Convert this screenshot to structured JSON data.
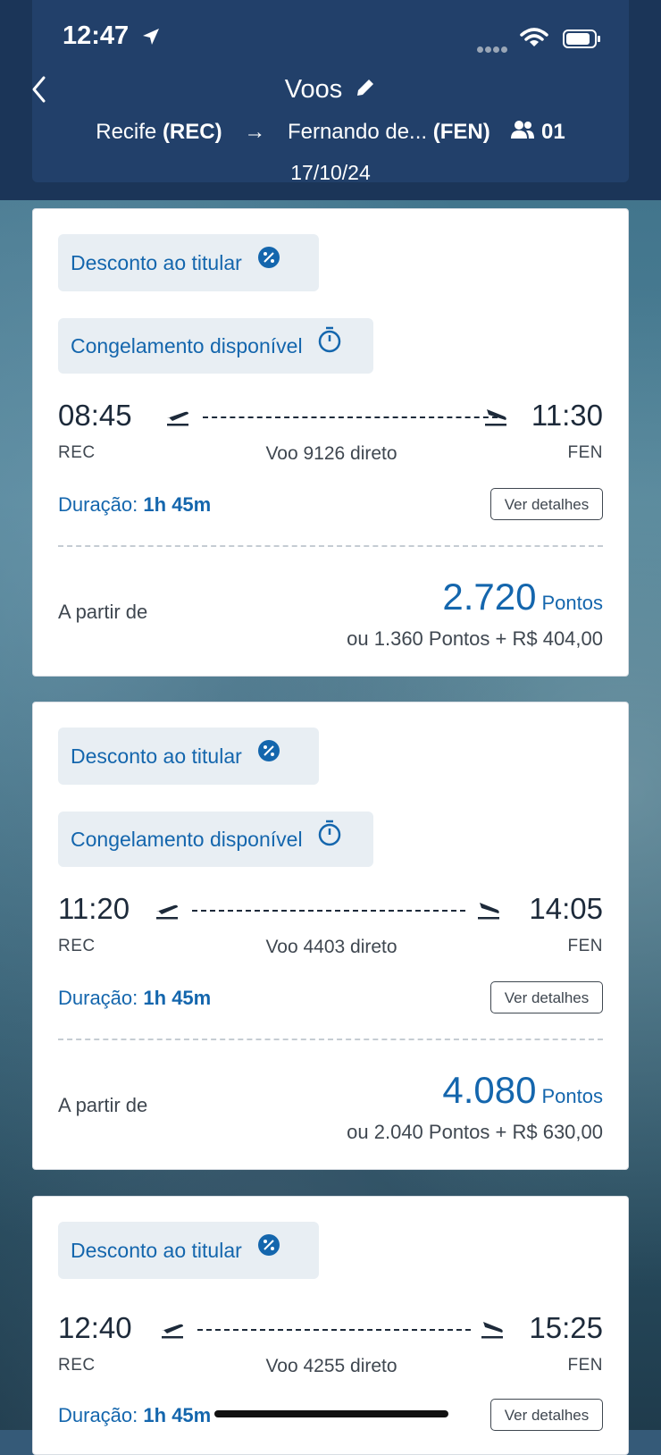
{
  "status_bar": {
    "time": "12:47"
  },
  "header": {
    "title": "Voos",
    "origin_city": "Recife",
    "origin_code": "(REC)",
    "destination_city": "Fernando de...",
    "destination_code": "(FEN)",
    "passengers": "01",
    "date": "17/10/24"
  },
  "flights": [
    {
      "badges": [
        "Desconto ao titular",
        "Congelamento disponível"
      ],
      "departure_time": "08:45",
      "arrival_time": "11:30",
      "origin": "REC",
      "destination": "FEN",
      "flight_label": "Voo 9126 direto",
      "duration_label": "Duração:",
      "duration": "1h 45m",
      "details_label": "Ver detalhes",
      "from_label": "A partir de",
      "points": "2.720",
      "points_unit": "Pontos",
      "alternative": "ou 1.360 Pontos + R$ 404,00"
    },
    {
      "badges": [
        "Desconto ao titular",
        "Congelamento disponível"
      ],
      "departure_time": "11:20",
      "arrival_time": "14:05",
      "origin": "REC",
      "destination": "FEN",
      "flight_label": "Voo 4403 direto",
      "duration_label": "Duração:",
      "duration": "1h 45m",
      "details_label": "Ver detalhes",
      "from_label": "A partir de",
      "points": "4.080",
      "points_unit": "Pontos",
      "alternative": "ou 2.040 Pontos + R$ 630,00"
    },
    {
      "badges": [
        "Desconto ao titular"
      ],
      "departure_time": "12:40",
      "arrival_time": "15:25",
      "origin": "REC",
      "destination": "FEN",
      "flight_label": "Voo 4255 direto",
      "duration_label": "Duração:",
      "duration": "1h 45m",
      "details_label": "Ver detalhes"
    }
  ],
  "colors": {
    "header_bg": "#1b3558",
    "accent_blue": "#1466ad",
    "chip_bg": "#e8eef3"
  }
}
